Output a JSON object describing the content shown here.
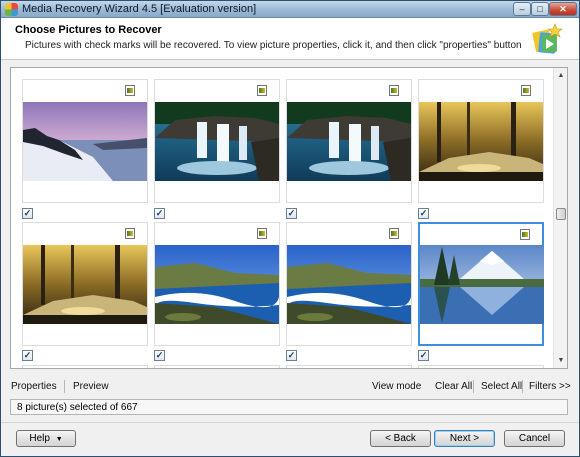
{
  "window": {
    "title": "Media Recovery Wizard 4.5 [Evaluation version]",
    "controls": {
      "minimize": "–",
      "maximize": "□",
      "close": "✕"
    }
  },
  "header": {
    "title": "Choose Pictures to Recover",
    "subtitle": "Pictures with check marks will be recovered. To view picture properties, click it, and then click \"properties\" button"
  },
  "gallery": {
    "thumbnails": [
      {
        "image": "winter-lake",
        "checked": true,
        "selected": false
      },
      {
        "image": "waterfall",
        "checked": true,
        "selected": false
      },
      {
        "image": "waterfall",
        "checked": true,
        "selected": false
      },
      {
        "image": "autumn-forest-stream",
        "checked": true,
        "selected": false
      },
      {
        "image": "autumn-forest-stream",
        "checked": true,
        "selected": false
      },
      {
        "image": "green-sand-beach",
        "checked": true,
        "selected": false
      },
      {
        "image": "green-sand-beach",
        "checked": true,
        "selected": false
      },
      {
        "image": "mountain-lake",
        "checked": true,
        "selected": true
      }
    ],
    "check_glyph": "✓"
  },
  "toolbar": {
    "properties": "Properties",
    "preview": "Preview",
    "view_mode": "View mode",
    "clear_all": "Clear All",
    "select_all": "Select All",
    "filters": "Filters >>"
  },
  "status": {
    "text": "8 picture(s) selected of 667"
  },
  "footer": {
    "help": "Help",
    "back": "< Back",
    "next": "Next >",
    "cancel": "Cancel"
  },
  "icons": {
    "app": "app-icon",
    "logo": "wizard-logo-icon",
    "file": "file-icon",
    "dropdown": "dropdown-arrow-icon"
  }
}
